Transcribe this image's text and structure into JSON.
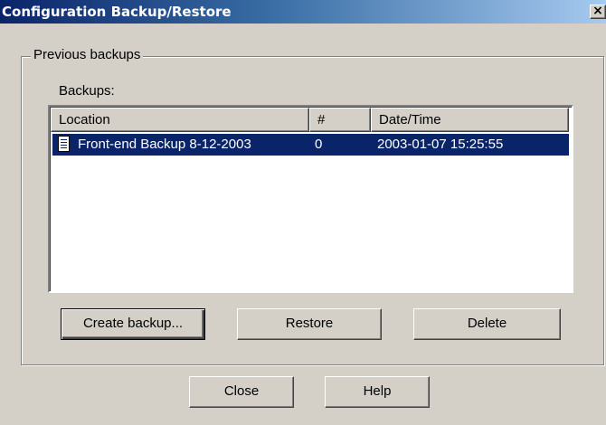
{
  "window": {
    "title": "Configuration Backup/Restore",
    "close_glyph": "×"
  },
  "group": {
    "legend": "Previous backups",
    "backups_label": "Backups:"
  },
  "list": {
    "columns": [
      "Location",
      "#",
      "Date/Time"
    ],
    "rows": [
      {
        "location": "Front-end Backup 8-12-2003",
        "number": "0",
        "datetime": "2003-01-07 15:25:55",
        "icon": "document-icon",
        "selected": true
      }
    ]
  },
  "buttons": {
    "create": "Create backup...",
    "restore": "Restore",
    "delete": "Delete",
    "close": "Close",
    "help": "Help"
  },
  "colors": {
    "selection": "#0a246a",
    "title_start": "#0a246a",
    "title_end": "#a6caf0",
    "face": "#d4d0c8"
  }
}
